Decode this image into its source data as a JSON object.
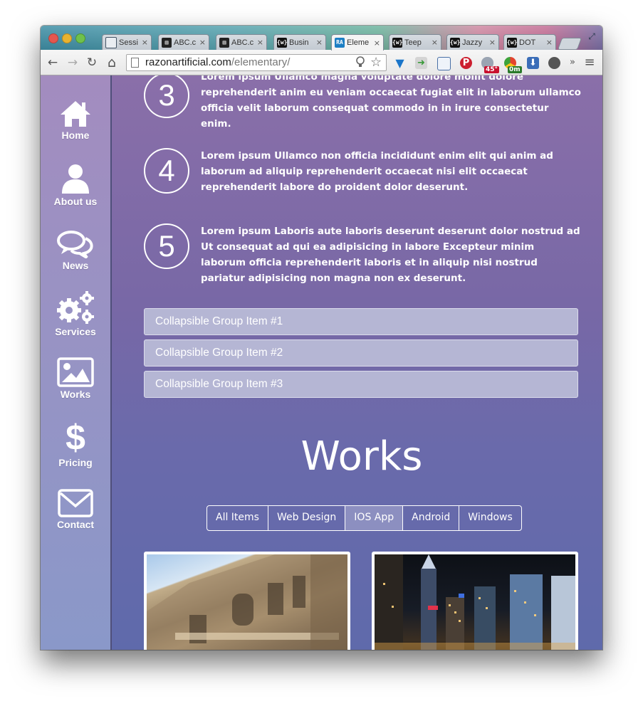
{
  "browser": {
    "tabs": [
      {
        "title": "Sessi",
        "favicon": "window-icon",
        "active": false
      },
      {
        "title": "ABC.c",
        "favicon": "building-icon",
        "active": false
      },
      {
        "title": "ABC.c",
        "favicon": "building-icon",
        "active": false
      },
      {
        "title": "Busin",
        "favicon": "w-icon",
        "active": false
      },
      {
        "title": "Eleme",
        "favicon": "ra-icon",
        "active": true
      },
      {
        "title": "Teep",
        "favicon": "w-icon",
        "active": false
      },
      {
        "title": "Jazzy",
        "favicon": "w-icon",
        "active": false
      },
      {
        "title": "DOT",
        "favicon": "w-icon",
        "active": false
      }
    ],
    "favicon_text": {
      "w": "{w}",
      "ra": "RA"
    },
    "tab_close": "×",
    "address": {
      "domain": "razonartificial.com",
      "path": "/elementary/"
    },
    "extensions": {
      "weather_badge": "45°",
      "timer_badge": "0m",
      "overflow": "»"
    },
    "icons": {
      "back": "←",
      "forward": "→",
      "reload": "↻",
      "home": "⌂",
      "menu": "≡",
      "star": "☆",
      "fullscreen": "⤢"
    }
  },
  "sidebar": {
    "items": [
      {
        "label": "Home",
        "icon": "home-icon"
      },
      {
        "label": "About us",
        "icon": "user-icon"
      },
      {
        "label": "News",
        "icon": "chat-bubbles-icon"
      },
      {
        "label": "Services",
        "icon": "gears-icon"
      },
      {
        "label": "Works",
        "icon": "picture-icon"
      },
      {
        "label": "Pricing",
        "icon": "dollar-icon"
      },
      {
        "label": "Contact",
        "icon": "envelope-icon"
      }
    ],
    "pricing_glyph": "$"
  },
  "steps": [
    {
      "number": "3",
      "text": "Lorem ipsum Ullamco magna voluptate dolore mollit dolore reprehenderit anim eu veniam occaecat fugiat elit in laborum ullamco officia velit laborum consequat commodo in in irure consectetur enim."
    },
    {
      "number": "4",
      "text": "Lorem ipsum Ullamco non officia incididunt enim elit qui anim ad laborum ad aliquip reprehenderit occaecat nisi elit occaecat reprehenderit labore do proident dolor deserunt."
    },
    {
      "number": "5",
      "text": "Lorem ipsum Laboris aute laboris deserunt deserunt dolor nostrud ad Ut consequat ad qui ea adipisicing in labore Excepteur minim laborum officia reprehenderit laboris et in aliquip nisi nostrud pariatur adipisicing non magna non ex deserunt."
    }
  ],
  "accordion": [
    {
      "label": "Collapsible Group Item #1"
    },
    {
      "label": "Collapsible Group Item #2"
    },
    {
      "label": "Collapsible Group Item #3"
    }
  ],
  "works": {
    "title": "Works",
    "filters": [
      "All Items",
      "Web Design",
      "IOS App",
      "Android",
      "Windows"
    ],
    "active_filter": "IOS App"
  },
  "colors": {
    "page_top": "#8a6fa9",
    "page_bottom": "#5f6aab",
    "sidebar": "#9893c4",
    "accordion": "#b5b6d4"
  }
}
